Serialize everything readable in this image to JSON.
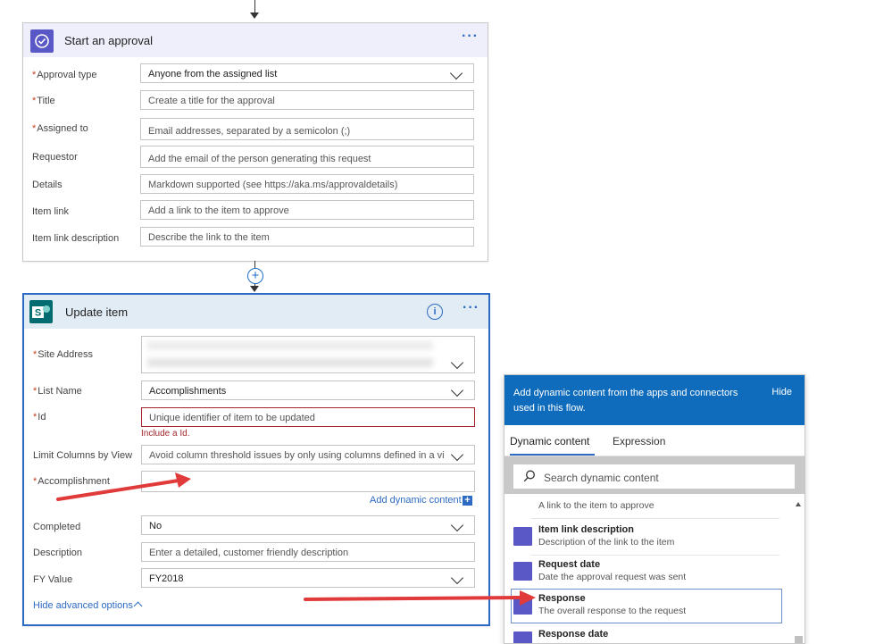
{
  "approval_card": {
    "title": "Start an approval",
    "more": "···",
    "fields": [
      {
        "label": "Approval type",
        "required": true,
        "value": "Anyone from the assigned list",
        "placeholder": ""
      },
      {
        "label": "Title",
        "required": true,
        "value": "",
        "placeholder": "Create a title for the approval"
      },
      {
        "label": "Assigned to",
        "required": true,
        "value": "",
        "placeholder": "Email addresses, separated by a semicolon (;)"
      },
      {
        "label": "Requestor",
        "required": false,
        "value": "",
        "placeholder": "Add the email of the person generating this request"
      },
      {
        "label": "Details",
        "required": false,
        "value": "",
        "placeholder": "Markdown supported (see https://aka.ms/approvaldetails)"
      },
      {
        "label": "Item link",
        "required": false,
        "value": "",
        "placeholder": "Add a link to the item to approve"
      },
      {
        "label": "Item link description",
        "required": false,
        "value": "",
        "placeholder": "Describe the link to the item"
      }
    ]
  },
  "update_card": {
    "title": "Update item",
    "more": "···",
    "info": "i",
    "fields": [
      {
        "label": "Site Address",
        "required": true,
        "value": "",
        "placeholder": ""
      },
      {
        "label": "List Name",
        "required": true,
        "value": "Accomplishments",
        "placeholder": ""
      },
      {
        "label": "Id",
        "required": true,
        "value": "",
        "placeholder": "Unique identifier of item to be updated"
      },
      {
        "label": "Limit Columns by View",
        "required": false,
        "value": "",
        "placeholder": "Avoid column threshold issues by only using columns defined in a view"
      },
      {
        "label": "Accomplishment",
        "required": true,
        "value": "",
        "placeholder": ""
      },
      {
        "label": "Completed",
        "required": false,
        "value": "No",
        "placeholder": ""
      },
      {
        "label": "Description",
        "required": false,
        "value": "",
        "placeholder": "Enter a detailed, customer friendly description"
      },
      {
        "label": "FY Value",
        "required": false,
        "value": "FY2018",
        "placeholder": ""
      }
    ],
    "id_error": "Include a Id.",
    "add_dynamic": "Add dynamic content",
    "hide_advanced": "Hide advanced options"
  },
  "dynamic_panel": {
    "header": "Add dynamic content from the apps and connectors used in this flow.",
    "hide": "Hide",
    "tabs": [
      "Dynamic content",
      "Expression"
    ],
    "search_placeholder": "Search dynamic content",
    "items": [
      {
        "title": "",
        "desc": "A link to the item to approve"
      },
      {
        "title": "Item link description",
        "desc": "Description of the link to the item"
      },
      {
        "title": "Request date",
        "desc": "Date the approval request was sent"
      },
      {
        "title": "Response",
        "desc": "The overall response to the request"
      },
      {
        "title": "Response date",
        "desc": ""
      }
    ]
  },
  "colors": {
    "accent_blue": "#0f6cbd",
    "approval_purple": "#5a57c6",
    "sharepoint_teal": "#036c70",
    "annotation_red": "#e03a3a"
  }
}
